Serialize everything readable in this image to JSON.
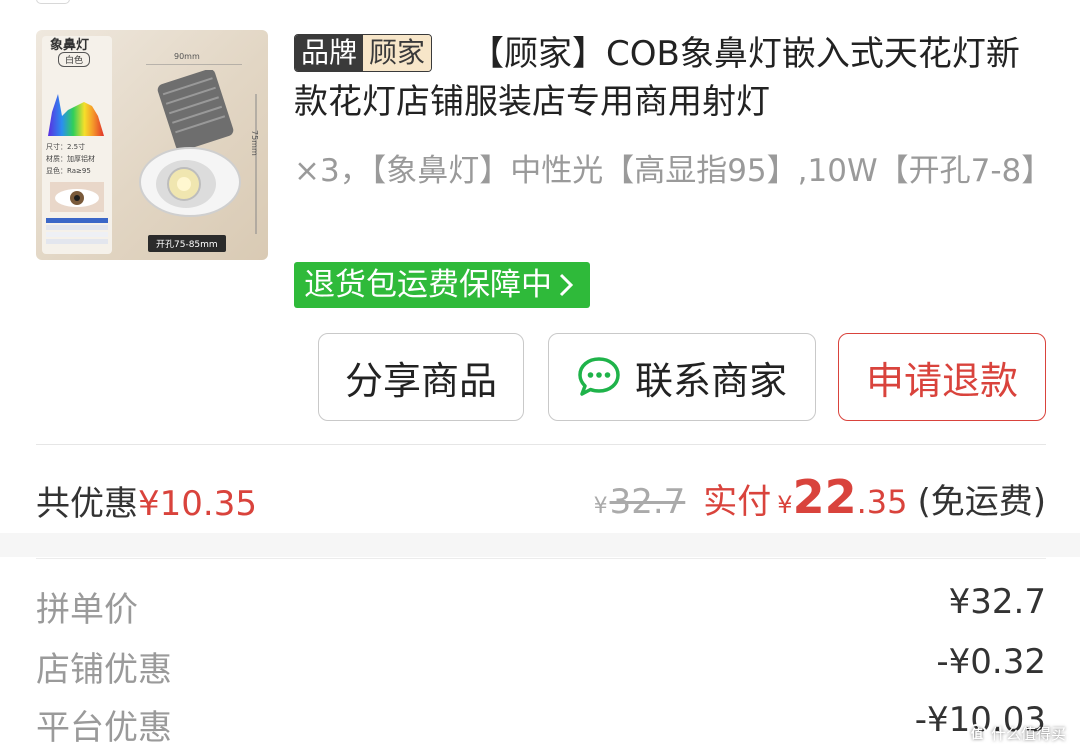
{
  "product": {
    "image": {
      "title": "象鼻灯",
      "color_tag": "白色",
      "spec_lines": [
        "尺寸：2.5寸",
        "材质：加厚铝材",
        "显色：Ra≥95"
      ],
      "dim_width": "90mm",
      "dim_height": "75mm",
      "hole_label": "开孔75-85mm"
    },
    "brand_label": "品牌",
    "brand_name": "顾家",
    "title": "【顾家】COB象鼻灯嵌入式天花灯新款花灯店铺服装店专用商用射灯",
    "spec": "×3，【象鼻灯】中性光【高显指95】,10W【开孔7-8】",
    "return_badge": "退货包运费保障中"
  },
  "actions": {
    "share": "分享商品",
    "contact": "联系商家",
    "refund": "申请退款",
    "refund_color": "#d9433c"
  },
  "summary": {
    "saving_label": "共优惠",
    "saving_amount": "¥10.35",
    "original_symbol": "¥",
    "original_price": "32.7",
    "paid_label": "实付",
    "paid_symbol": "¥",
    "paid_int": "22",
    "paid_dec": ".35",
    "shipping": "(免运费)"
  },
  "details": [
    {
      "label": "拼单价",
      "value": "¥32.7"
    },
    {
      "label": "店铺优惠",
      "value": "-¥0.32"
    },
    {
      "label": "平台优惠",
      "value": "-¥10.03"
    }
  ],
  "watermark": {
    "logo": "值",
    "text": "什么值得买"
  },
  "colors": {
    "accent_red": "#d9433c",
    "badge_green": "#2fba3a"
  }
}
